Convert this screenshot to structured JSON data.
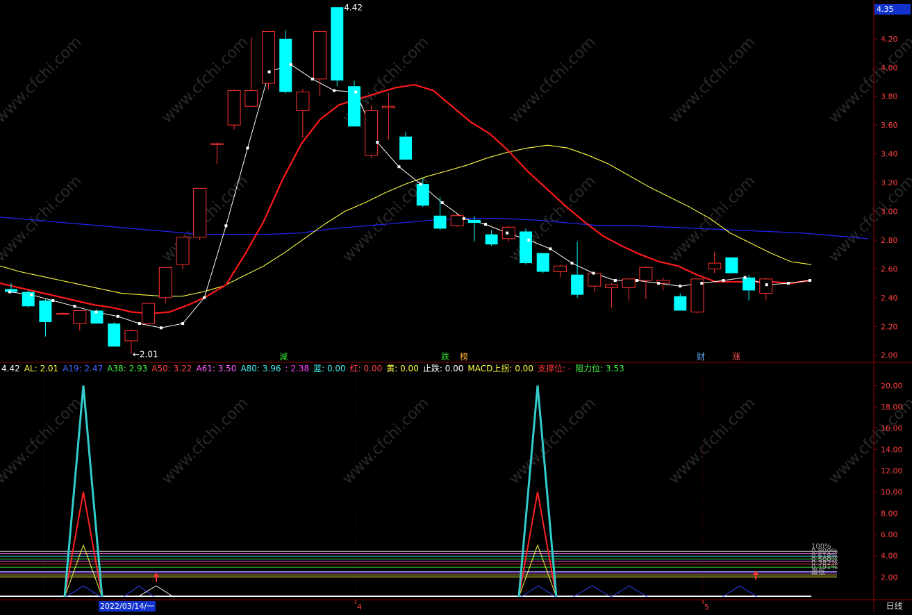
{
  "price_axis": {
    "ticks": [
      "4.20",
      "4.00",
      "3.80",
      "3.60",
      "3.40",
      "3.20",
      "3.00",
      "2.80",
      "2.60",
      "2.40",
      "2.20",
      "2.00"
    ],
    "current_price": "4.35"
  },
  "price_annotations": {
    "high": "4.42",
    "low": "←2.01"
  },
  "signals": [
    {
      "text": "減",
      "color": "#33dd33"
    },
    {
      "text": "跌",
      "color": "#33dd33"
    },
    {
      "text": "榜",
      "color": "#ffaa33"
    },
    {
      "text": "财",
      "color": "#66aaff"
    },
    {
      "text": "涨",
      "color": "#ff5555"
    }
  ],
  "legend": [
    {
      "text": "4.42",
      "color": "#ffffff"
    },
    {
      "text": "AL: 2.01",
      "color": "#ffff44"
    },
    {
      "text": "A19: 2.47",
      "color": "#4466ff"
    },
    {
      "text": "A38: 2.93",
      "color": "#44ee44"
    },
    {
      "text": "A50: 3.22",
      "color": "#ff4444"
    },
    {
      "text": "A61: 3.50",
      "color": "#ff66ff"
    },
    {
      "text": "A80: 3.96",
      "color": "#44eeee"
    },
    {
      "text": ": 2.38",
      "color": "#ff44ff"
    },
    {
      "text": "蓝: 0.00",
      "color": "#44eeee"
    },
    {
      "text": "红: 0.00",
      "color": "#ff4444"
    },
    {
      "text": "黄: 0.00",
      "color": "#ffff44"
    },
    {
      "text": "止跌: 0.00",
      "color": "#ffffff"
    },
    {
      "text": "MACD上拐: 0.00",
      "color": "#ffff44"
    },
    {
      "text": "支撑位: -",
      "color": "#ff3333"
    },
    {
      "text": "阻力位: 3.53",
      "color": "#44ee44"
    }
  ],
  "indicator_axis": {
    "ticks": [
      "20.00",
      "18.00",
      "16.00",
      "14.00",
      "12.00",
      "10.00",
      "8.00",
      "6.00",
      "4.00",
      "2.00"
    ]
  },
  "fib_labels": [
    "100%",
    "0.809%",
    "0.618%",
    "0.500%",
    "0.382%",
    "0.191%",
    "最低"
  ],
  "time_axis": {
    "labels": [
      "4",
      "5"
    ],
    "date_badge": "2022/03/14/一",
    "period_tab": "日线"
  },
  "watermark": "www.cfchi.com",
  "colors": {
    "up": "#ff3232",
    "down": "#00ffff",
    "ma5": "#ffffff",
    "ma10": "#ff1a1a",
    "ma20": "#ffff44",
    "ma60": "#2222ee",
    "grid": "#8b0000"
  },
  "chart_data": {
    "type": "candlestick",
    "ylim": [
      1.96,
      4.45
    ],
    "candles": [
      {
        "o": 2.46,
        "h": 2.5,
        "l": 2.43,
        "c": 2.44
      },
      {
        "o": 2.44,
        "h": 2.45,
        "l": 2.33,
        "c": 2.34
      },
      {
        "o": 2.38,
        "h": 2.39,
        "l": 2.13,
        "c": 2.23
      },
      {
        "o": 2.29,
        "h": 2.3,
        "l": 2.28,
        "c": 2.29
      },
      {
        "o": 2.22,
        "h": 2.31,
        "l": 2.17,
        "c": 2.31
      },
      {
        "o": 2.31,
        "h": 2.32,
        "l": 2.22,
        "c": 2.22
      },
      {
        "o": 2.22,
        "h": 2.23,
        "l": 2.06,
        "c": 2.06
      },
      {
        "o": 2.1,
        "h": 2.18,
        "l": 2.01,
        "c": 2.17
      },
      {
        "o": 2.22,
        "h": 2.36,
        "l": 2.21,
        "c": 2.36
      },
      {
        "o": 2.4,
        "h": 2.61,
        "l": 2.36,
        "c": 2.61
      },
      {
        "o": 2.63,
        "h": 2.81,
        "l": 2.6,
        "c": 2.82
      },
      {
        "o": 2.82,
        "h": 3.16,
        "l": 2.8,
        "c": 3.16
      },
      {
        "o": 3.47,
        "h": 3.48,
        "l": 3.33,
        "c": 3.47
      },
      {
        "o": 3.6,
        "h": 3.85,
        "l": 3.57,
        "c": 3.84
      },
      {
        "o": 3.73,
        "h": 4.21,
        "l": 3.73,
        "c": 3.84
      },
      {
        "o": 3.89,
        "h": 4.25,
        "l": 3.85,
        "c": 4.25
      },
      {
        "o": 4.2,
        "h": 4.26,
        "l": 3.82,
        "c": 3.83
      },
      {
        "o": 3.7,
        "h": 3.85,
        "l": 3.51,
        "c": 3.83
      },
      {
        "o": 3.92,
        "h": 4.25,
        "l": 3.8,
        "c": 4.25
      },
      {
        "o": 4.42,
        "h": 4.42,
        "l": 3.87,
        "c": 3.91
      },
      {
        "o": 3.87,
        "h": 3.91,
        "l": 3.59,
        "c": 3.59
      },
      {
        "o": 3.39,
        "h": 3.74,
        "l": 3.37,
        "c": 3.7
      },
      {
        "o": 3.72,
        "h": 3.82,
        "l": 3.5,
        "c": 3.73
      },
      {
        "o": 3.52,
        "h": 3.55,
        "l": 3.36,
        "c": 3.36
      },
      {
        "o": 3.19,
        "h": 3.23,
        "l": 3.03,
        "c": 3.04
      },
      {
        "o": 2.97,
        "h": 3.1,
        "l": 2.87,
        "c": 2.88
      },
      {
        "o": 2.9,
        "h": 2.98,
        "l": 2.89,
        "c": 2.97
      },
      {
        "o": 2.94,
        "h": 2.97,
        "l": 2.79,
        "c": 2.92
      },
      {
        "o": 2.84,
        "h": 2.87,
        "l": 2.76,
        "c": 2.77
      },
      {
        "o": 2.81,
        "h": 2.9,
        "l": 2.79,
        "c": 2.89
      },
      {
        "o": 2.86,
        "h": 2.88,
        "l": 2.63,
        "c": 2.64
      },
      {
        "o": 2.71,
        "h": 2.71,
        "l": 2.57,
        "c": 2.58
      },
      {
        "o": 2.58,
        "h": 2.63,
        "l": 2.54,
        "c": 2.62
      },
      {
        "o": 2.56,
        "h": 2.79,
        "l": 2.4,
        "c": 2.42
      },
      {
        "o": 2.48,
        "h": 2.58,
        "l": 2.44,
        "c": 2.57
      },
      {
        "o": 2.47,
        "h": 2.5,
        "l": 2.33,
        "c": 2.49
      },
      {
        "o": 2.47,
        "h": 2.53,
        "l": 2.38,
        "c": 2.53
      },
      {
        "o": 2.52,
        "h": 2.62,
        "l": 2.39,
        "c": 2.61
      },
      {
        "o": 2.5,
        "h": 2.54,
        "l": 2.45,
        "c": 2.52
      },
      {
        "o": 2.41,
        "h": 2.43,
        "l": 2.31,
        "c": 2.31
      },
      {
        "o": 2.3,
        "h": 2.53,
        "l": 2.29,
        "c": 2.53
      },
      {
        "o": 2.6,
        "h": 2.72,
        "l": 2.57,
        "c": 2.64
      },
      {
        "o": 2.68,
        "h": 2.68,
        "l": 2.57,
        "c": 2.57
      },
      {
        "o": 2.54,
        "h": 2.56,
        "l": 2.38,
        "c": 2.45
      },
      {
        "o": 2.43,
        "h": 2.54,
        "l": 2.38,
        "c": 2.53
      }
    ],
    "ma5": [
      2.44,
      2.42,
      2.38,
      2.34,
      2.3,
      2.27,
      2.22,
      2.19,
      2.22,
      2.4,
      2.9,
      3.44,
      3.97,
      4.02,
      3.92,
      3.84,
      3.83,
      3.48,
      3.31,
      3.19,
      3.06,
      2.95,
      2.91,
      2.85,
      2.8,
      2.74,
      2.64,
      2.57,
      2.52,
      2.52,
      2.5,
      2.48,
      2.5,
      2.52,
      2.54,
      2.49,
      2.5,
      2.52
    ],
    "ma10": [
      2.5,
      2.47,
      2.44,
      2.41,
      2.38,
      2.35,
      2.33,
      2.3,
      2.29,
      2.3,
      2.35,
      2.41,
      2.49,
      2.7,
      2.93,
      3.22,
      3.47,
      3.64,
      3.74,
      3.78,
      3.82,
      3.86,
      3.88,
      3.84,
      3.73,
      3.62,
      3.54,
      3.42,
      3.28,
      3.16,
      3.04,
      2.93,
      2.83,
      2.76,
      2.7,
      2.65,
      2.62,
      2.56,
      2.51,
      2.51,
      2.51,
      2.51,
      2.5,
      2.52
    ],
    "ma20": [
      2.62,
      2.58,
      2.55,
      2.52,
      2.49,
      2.46,
      2.43,
      2.42,
      2.41,
      2.41,
      2.44,
      2.48,
      2.55,
      2.62,
      2.71,
      2.81,
      2.91,
      3.0,
      3.06,
      3.13,
      3.19,
      3.24,
      3.28,
      3.32,
      3.37,
      3.41,
      3.44,
      3.46,
      3.44,
      3.39,
      3.33,
      3.25,
      3.17,
      3.1,
      3.03,
      2.95,
      2.85,
      2.78,
      2.71,
      2.65,
      2.63
    ],
    "ma60": [
      2.96,
      2.94,
      2.92,
      2.9,
      2.88,
      2.86,
      2.84,
      2.84,
      2.84,
      2.85,
      2.88,
      2.9,
      2.92,
      2.94,
      2.95,
      2.95,
      2.94,
      2.92,
      2.9,
      2.9,
      2.89,
      2.88,
      2.87,
      2.86,
      2.85,
      2.83,
      2.81
    ],
    "indicator": {
      "ylim": [
        0.0,
        21.0
      ],
      "spikes": [
        {
          "index": 4,
          "cyan": 20,
          "red": 10,
          "yellow": 5
        },
        {
          "index": 29,
          "cyan": 20,
          "red": 10,
          "yellow": 5
        }
      ],
      "levels": [
        4.42,
        4.2,
        3.96,
        3.7,
        3.5,
        3.22,
        2.93,
        2.5,
        2.47,
        2.38,
        2.2,
        2.01
      ]
    }
  }
}
